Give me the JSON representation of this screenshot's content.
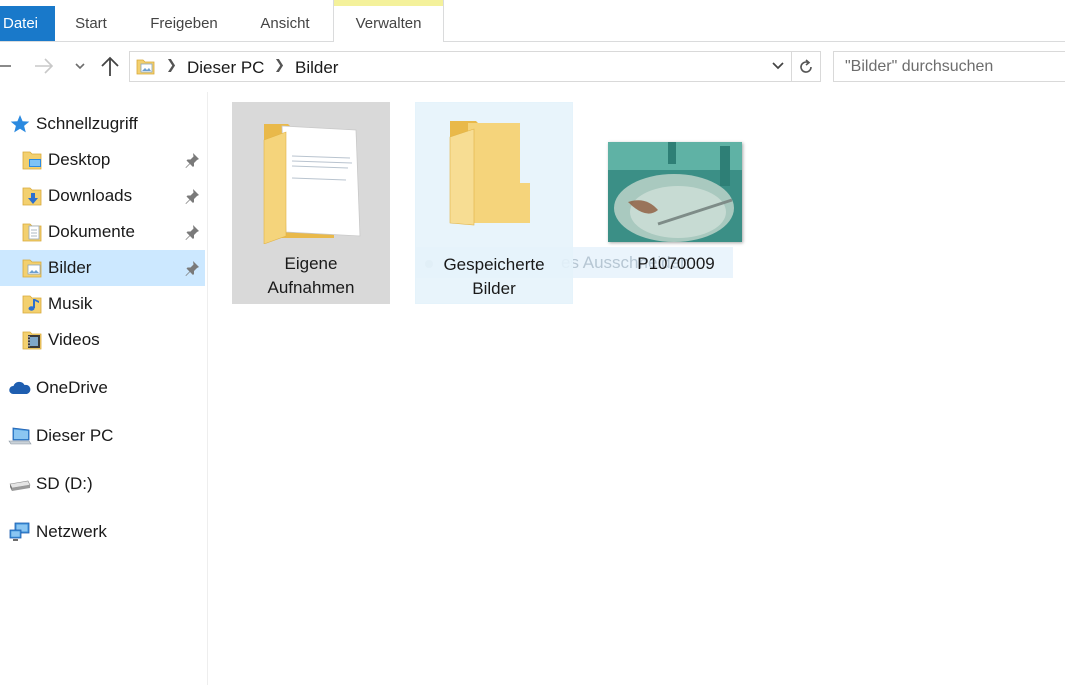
{
  "ribbon": {
    "tabs": [
      {
        "label": "Datei"
      },
      {
        "label": "Start"
      },
      {
        "label": "Freigeben"
      },
      {
        "label": "Ansicht"
      },
      {
        "label": "Verwalten"
      }
    ],
    "contextual_color": "#f4f19b",
    "file_tab_color": "#1979ca"
  },
  "address": {
    "breadcrumbs": [
      "Dieser PC",
      "Bilder"
    ],
    "search_placeholder": "\"Bilder\" durchsuchen"
  },
  "navigation": {
    "items": [
      {
        "label": "Schnellzugriff",
        "icon": "star-icon"
      },
      {
        "label": "Desktop",
        "icon": "desktop-folder-icon",
        "pinned": true
      },
      {
        "label": "Downloads",
        "icon": "downloads-folder-icon",
        "pinned": true
      },
      {
        "label": "Dokumente",
        "icon": "documents-folder-icon",
        "pinned": true
      },
      {
        "label": "Bilder",
        "icon": "pictures-folder-icon",
        "pinned": true,
        "selected": true
      },
      {
        "label": "Musik",
        "icon": "music-folder-icon"
      },
      {
        "label": "Videos",
        "icon": "videos-folder-icon"
      },
      {
        "label": "OneDrive",
        "icon": "cloud-icon"
      },
      {
        "label": "Dieser PC",
        "icon": "computer-icon"
      },
      {
        "label": "SD (D:)",
        "icon": "drive-icon"
      },
      {
        "label": "Netzwerk",
        "icon": "network-icon"
      }
    ],
    "selected_color": "#cce8ff"
  },
  "content": {
    "items": [
      {
        "label_line1": "Eigene",
        "label_line2": "Aufnahmen",
        "type": "folder"
      },
      {
        "label_line1": "Gespeicherte",
        "label_line2": "Bilder",
        "type": "folder"
      },
      {
        "label": "P1070009",
        "type": "image"
      }
    ],
    "ghost_drag_label": "es Ausschneiden"
  }
}
